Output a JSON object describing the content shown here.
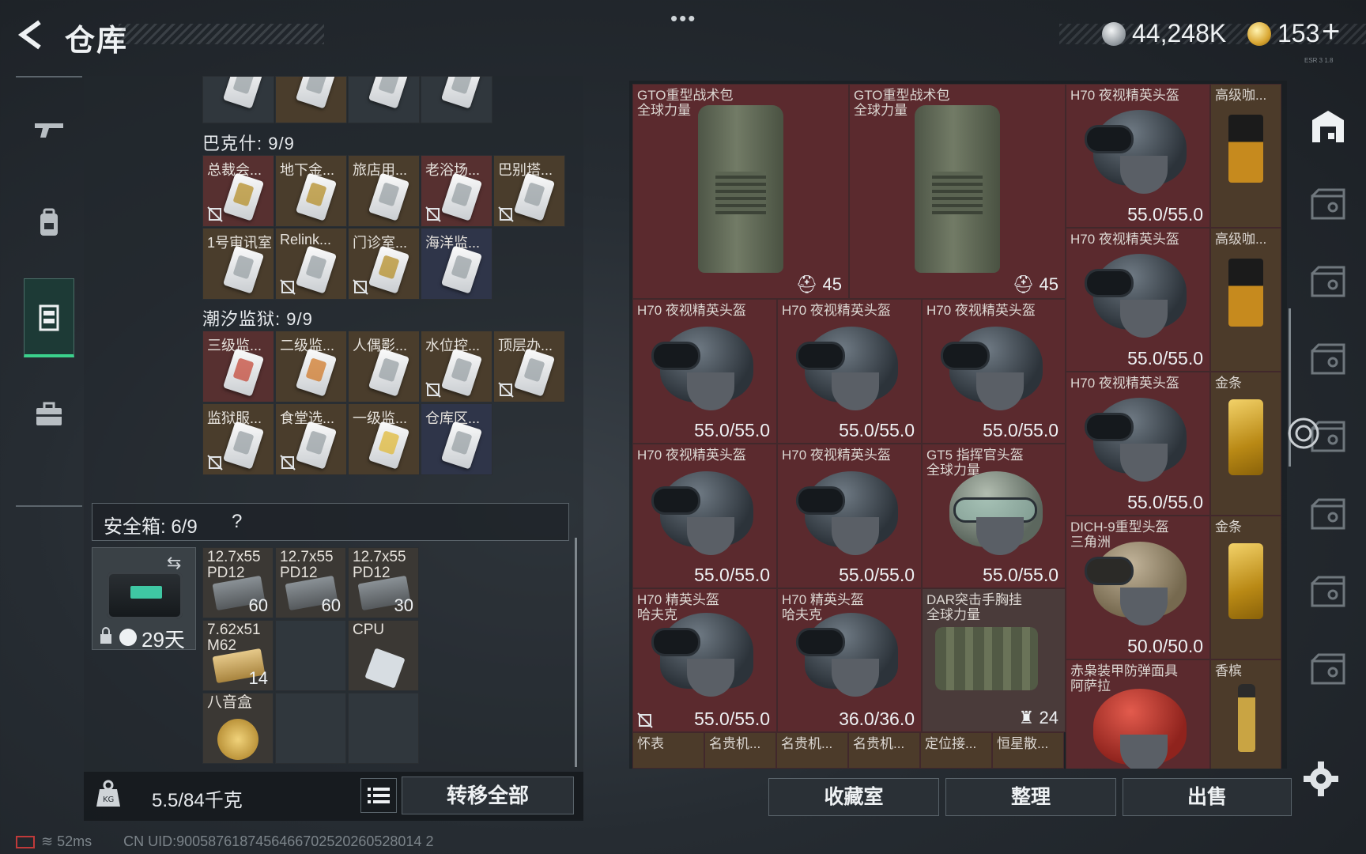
{
  "header": {
    "title": "仓库",
    "more": "•••",
    "currency1": "44,248K",
    "currency2": "153",
    "plus": "+",
    "tiny": "ESR 3 1.8"
  },
  "left_nav": [
    "gun-icon",
    "backpack-icon",
    "storage-icon",
    "briefcase-icon"
  ],
  "top_partial_row": [
    "",
    "",
    "",
    ""
  ],
  "group1": {
    "title": "巴克什: 9/9",
    "row1": [
      "总裁会...",
      "地下金...",
      "旅店用...",
      "老浴场...",
      "巴别塔..."
    ],
    "row2": [
      "1号审讯室",
      "Relink...",
      "门诊室...",
      "海洋监..."
    ]
  },
  "group2": {
    "title": "潮汐监狱: 9/9",
    "row1": [
      "三级监...",
      "二级监...",
      "人偶影...",
      "水位控...",
      "顶层办..."
    ],
    "row2": [
      "监狱服...",
      "食堂选...",
      "一级监...",
      "仓库区..."
    ]
  },
  "safe_box": {
    "label": "安全箱: 6/9",
    "help": "?",
    "days": "29天",
    "items": [
      {
        "name": "12.7x55\nPD12",
        "count": "60"
      },
      {
        "name": "12.7x55\nPD12",
        "count": "60"
      },
      {
        "name": "12.7x55\nPD12",
        "count": "30"
      },
      {
        "name": "7.62x51\nM62",
        "count": "14"
      },
      {
        "name": "CPU",
        "count": ""
      },
      {
        "name": "八音盒",
        "count": ""
      }
    ]
  },
  "footer": {
    "weight": "5.5/84千克",
    "transfer_all": "转移全部"
  },
  "status_bar": {
    "ping": "52ms",
    "uid": "CN UID:9005876187456466702520260528014 2"
  },
  "stash": {
    "backpacks": [
      {
        "name": "GTO重型战术包\n全球力量",
        "count": "45"
      },
      {
        "name": "GTO重型战术包\n全球力量",
        "count": "45"
      }
    ],
    "h70_label": "H70 夜视精英头盔",
    "gt5": {
      "name": "GT5 指挥官头盔\n全球力量",
      "value": "55.0/55.0"
    },
    "h70_elite": "H70 精英头盔\n哈夫克",
    "dar": {
      "name": "DAR突击手胸挂\n全球力量",
      "count": "24"
    },
    "dich": {
      "name": "DICH-9重型头盔\n三角洲",
      "value": "50.0/50.0"
    },
    "arzal": "赤枭装甲防弹面具\n阿萨拉",
    "coffee": "高级咖...",
    "gold": "金条",
    "champagne": "香槟",
    "full55": "55.0/55.0",
    "full36": "36.0/36.0",
    "bottom_row": [
      "怀表",
      "名贵机...",
      "名贵机...",
      "名贵机...",
      "定位接...",
      "恒星散..."
    ]
  },
  "actions": {
    "collection": "收藏室",
    "organize": "整理",
    "sell": "出售"
  },
  "colors": {
    "accent_green": "#3bd18c",
    "stash_red": "#5b2a2e",
    "panel": "#262c32"
  }
}
